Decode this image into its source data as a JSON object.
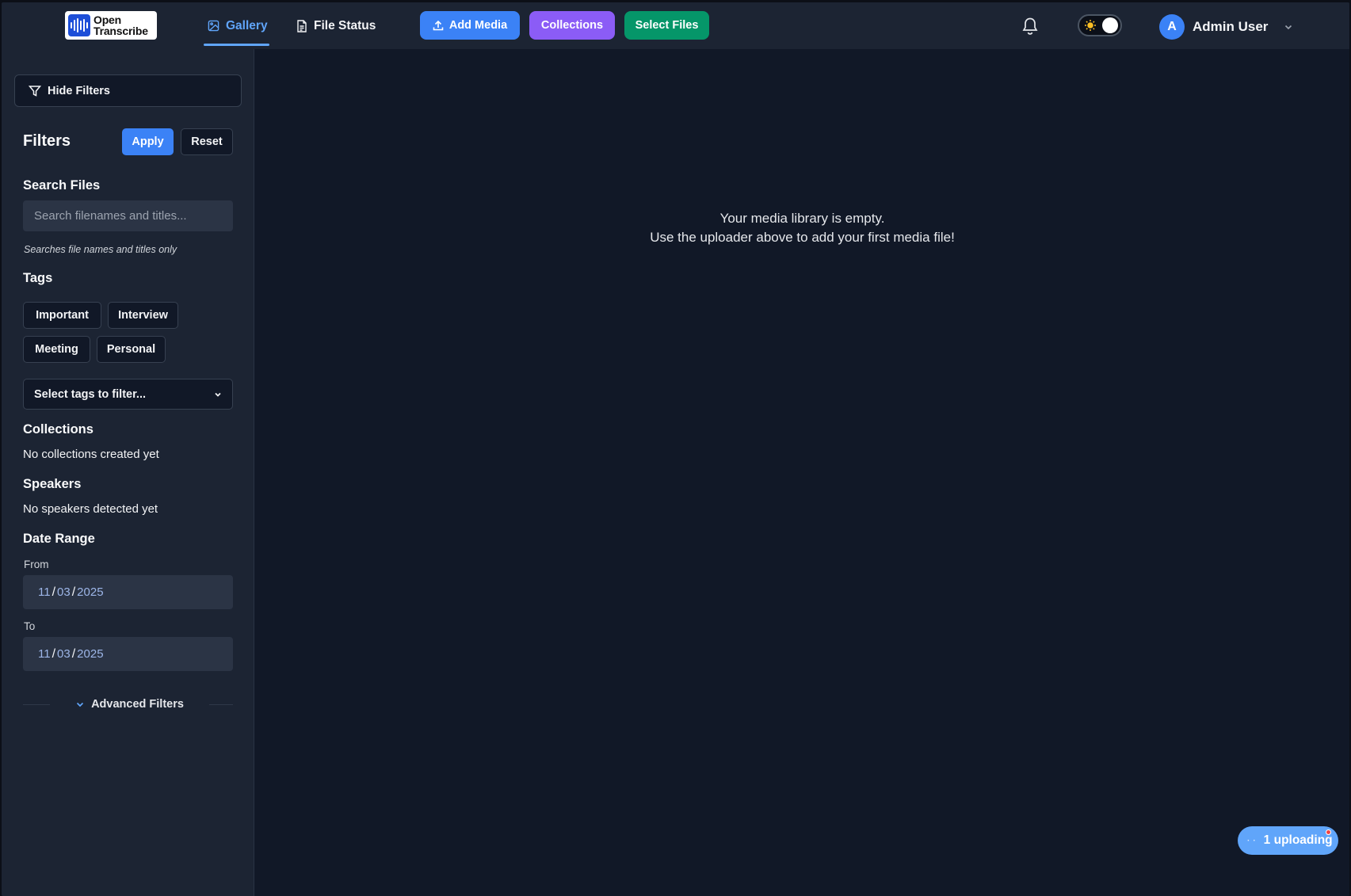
{
  "header": {
    "logo": {
      "line1": "Open",
      "line2": "Transcribe"
    },
    "tabs": [
      {
        "label": "Gallery",
        "icon": "image-icon",
        "active": true
      },
      {
        "label": "File Status",
        "icon": "document-icon",
        "active": false
      }
    ],
    "buttons": {
      "add_media": {
        "label": "Add Media",
        "icon": "upload-icon",
        "color": "#3b82f6"
      },
      "collections": {
        "label": "Collections",
        "color": "#8b5cf6"
      },
      "select_files": {
        "label": "Select Files",
        "color": "#059669"
      }
    },
    "notifications_icon": "bell-icon",
    "theme_toggle": {
      "icon": "sun-icon",
      "state": "light-toggle"
    },
    "user": {
      "initial": "A",
      "name": "Admin User",
      "avatar_color": "#3b82f6"
    }
  },
  "sidebar": {
    "hide_filters_label": "Hide Filters",
    "title": "Filters",
    "apply_label": "Apply",
    "reset_label": "Reset",
    "search": {
      "title": "Search Files",
      "placeholder": "Search filenames and titles...",
      "value": "",
      "hint": "Searches file names and titles only"
    },
    "tags": {
      "title": "Tags",
      "items": [
        "Important",
        "Interview",
        "Meeting",
        "Personal"
      ],
      "select_label": "Select tags to filter..."
    },
    "collections": {
      "title": "Collections",
      "empty": "No collections created yet"
    },
    "speakers": {
      "title": "Speakers",
      "empty": "No speakers detected yet"
    },
    "date_range": {
      "title": "Date Range",
      "from": {
        "label": "From",
        "month": "11",
        "day": "03",
        "year": "2025"
      },
      "to": {
        "label": "To",
        "month": "11",
        "day": "03",
        "year": "2025"
      }
    },
    "advanced_label": "Advanced Filters"
  },
  "main": {
    "empty_line1": "Your media library is empty.",
    "empty_line2": "Use the uploader above to add your first media file!"
  },
  "upload_status": {
    "label": "1 uploading",
    "color": "#60a5fa"
  }
}
